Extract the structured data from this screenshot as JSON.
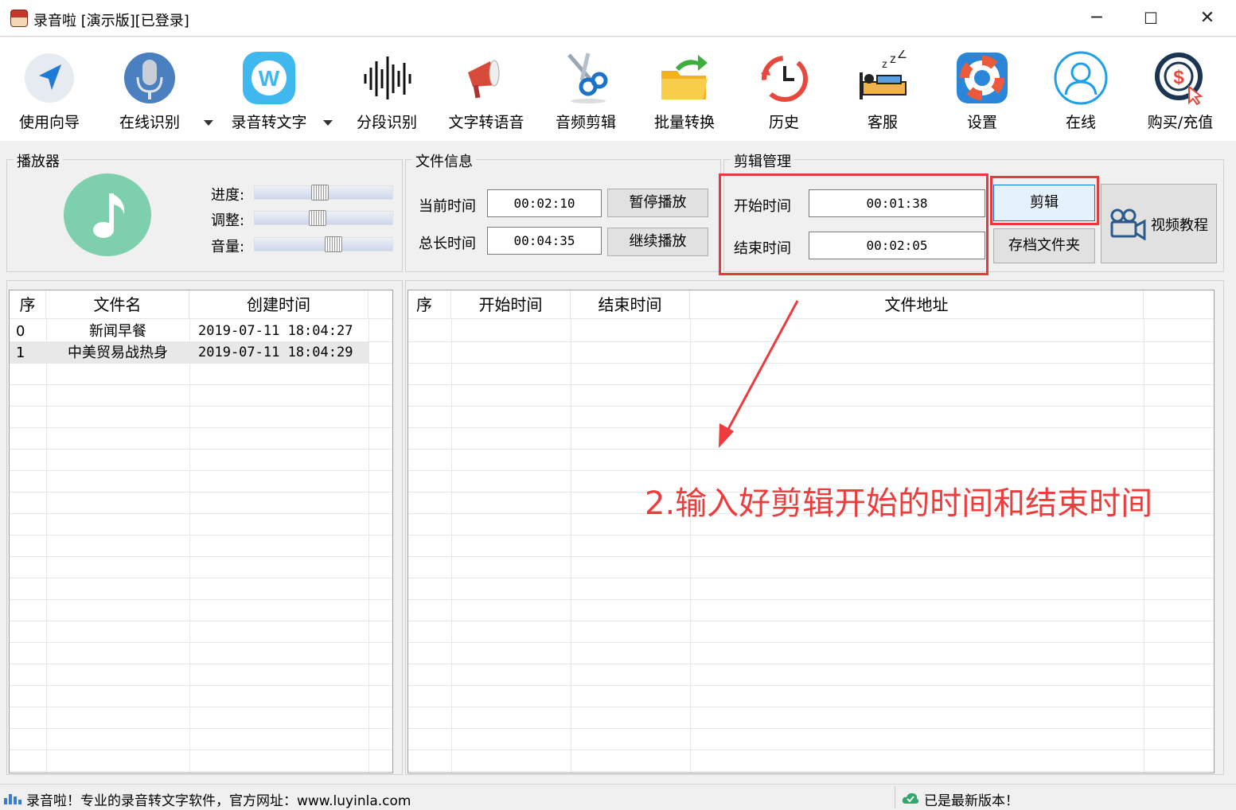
{
  "window": {
    "title": "录音啦 [演示版][已登录]",
    "minimize": "─",
    "maximize": "☐",
    "close": "✕"
  },
  "toolbar": [
    {
      "label": "使用向导",
      "icon": "compass-arrow-icon"
    },
    {
      "label": "在线识别",
      "icon": "microphone-icon"
    },
    {
      "label": "录音转文字",
      "icon": "w-badge-icon"
    },
    {
      "label": "分段识别",
      "icon": "waveform-icon"
    },
    {
      "label": "文字转语音",
      "icon": "megaphone-icon"
    },
    {
      "label": "音频剪辑",
      "icon": "scissors-icon"
    },
    {
      "label": "批量转换",
      "icon": "folder-icon"
    },
    {
      "label": "历史",
      "icon": "history-clock-icon"
    },
    {
      "label": "客服",
      "icon": "sleeping-bed-icon"
    },
    {
      "label": "设置",
      "icon": "lifebuoy-icon"
    },
    {
      "label": "在线",
      "icon": "user-circle-icon"
    },
    {
      "label": "购买/充值",
      "icon": "dollar-icon"
    }
  ],
  "player": {
    "title": "播放器",
    "progress_label": "进度:",
    "adjust_label": "调整:",
    "volume_label": "音量:",
    "progress": 0.47,
    "adjust": 0.45,
    "volume": 0.58
  },
  "file_info": {
    "title": "文件信息",
    "current_label": "当前时间",
    "current_value": "00:02:10",
    "total_label": "总长时间",
    "total_value": "00:04:35",
    "pause_button": "暂停播放",
    "resume_button": "继续播放"
  },
  "clip": {
    "title": "剪辑管理",
    "start_label": "开始时间",
    "start_value": "00:01:38",
    "end_label": "结束时间",
    "end_value": "00:02:05",
    "cut_button": "剪辑",
    "folder_button": "存档文件夹",
    "tutorial_button": "视频教程"
  },
  "file_list": {
    "headers": [
      "序",
      "文件名",
      "创建时间"
    ],
    "rows": [
      {
        "idx": "0",
        "name": "新闻早餐",
        "created": "2019-07-11 18:04:27"
      },
      {
        "idx": "1",
        "name": "中美贸易战热身",
        "created": "2019-07-11 18:04:29"
      }
    ]
  },
  "clip_list": {
    "headers": [
      "序",
      "开始时间",
      "结束时间",
      "文件地址"
    ]
  },
  "annotation": "2.输入好剪辑开始的时间和结束时间",
  "status": {
    "left": "录音啦！专业的录音转文字软件，官方网址：www.luyinla.com",
    "right": "已是最新版本！"
  }
}
